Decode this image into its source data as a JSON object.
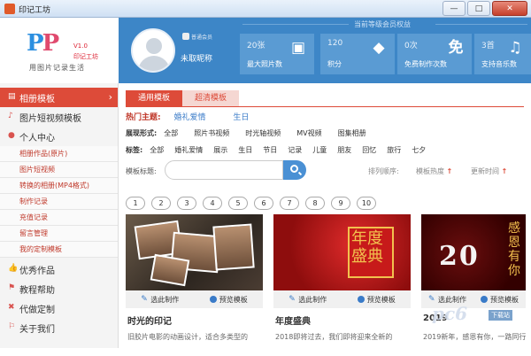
{
  "window": {
    "title": "印记工坊",
    "minimize": "—",
    "maximize": "□",
    "close": "✕"
  },
  "logo": {
    "mark_p1": "P",
    "mark_p2": "P",
    "version": "V1.0",
    "name": "印记工坊",
    "slogan": "用图片记录生活"
  },
  "user": {
    "badge_text": "普通会员",
    "nickname": "未取昵称"
  },
  "vip": {
    "title": "当前等级会员权益",
    "stats": [
      {
        "value": "20张",
        "label": "最大照片数",
        "icon": "image-icon",
        "glyph": "▣"
      },
      {
        "value": "120",
        "label": "积分",
        "icon": "diamond-icon",
        "glyph": "◆"
      },
      {
        "value": "0次",
        "label": "免费制作次数",
        "icon": "free-icon",
        "glyph": "免"
      },
      {
        "value": "3首",
        "label": "支持音乐数",
        "icon": "music-icon",
        "glyph": "♫"
      }
    ]
  },
  "sidebar": {
    "main_items": [
      {
        "label": "相册模板",
        "icon": "album-icon",
        "glyph": "▤",
        "active": true
      },
      {
        "label": "图片短视频模板",
        "icon": "tiktok-icon",
        "glyph": "♪"
      },
      {
        "label": "个人中心",
        "icon": "user-icon",
        "glyph": "●"
      }
    ],
    "sub_items": [
      "相册作品(原片)",
      "图片短视频",
      "转换的相册(MP4格式)",
      "制作记录",
      "充值记录",
      "留言管理",
      "我的定制模板"
    ],
    "bottom_items": [
      {
        "label": "优秀作品",
        "icon": "thumb-up-icon",
        "glyph": "👍"
      },
      {
        "label": "教程帮助",
        "icon": "help-icon",
        "glyph": "⚑"
      },
      {
        "label": "代做定制",
        "icon": "tools-icon",
        "glyph": "✖"
      },
      {
        "label": "关于我们",
        "icon": "info-icon",
        "glyph": "⚐"
      }
    ]
  },
  "tabs": [
    "通用模板",
    "超清模板"
  ],
  "hot_topics": {
    "label": "热门主题:",
    "items": [
      "婚礼爱情",
      "生日"
    ]
  },
  "filters": {
    "display": {
      "label": "展现形式:",
      "items": [
        "全部",
        "照片书视频",
        "时光轴视频",
        "MV视频",
        "图集相册"
      ]
    },
    "tags": {
      "label": "标签:",
      "items": [
        "全部",
        "婚礼爱情",
        "展示",
        "生日",
        "节日",
        "记录",
        "儿童",
        "朋友",
        "回忆",
        "旅行",
        "七夕"
      ]
    }
  },
  "search": {
    "label": "模板标题:",
    "placeholder": ""
  },
  "sort": {
    "label": "排列顺序:",
    "hot": "模板热度",
    "time": "更新时间",
    "up": "↑"
  },
  "pagination": [
    "1",
    "2",
    "3",
    "4",
    "5",
    "6",
    "7",
    "8",
    "9",
    "10"
  ],
  "cards": [
    {
      "title": "时光的印记",
      "desc": "旧胶片电影的动画设计，适合多类型的",
      "make": "选此制作",
      "preview": "预览模板"
    },
    {
      "title": "年度盛典",
      "desc": "2018即将过去，我们即将迎来全新的",
      "make": "选此制作",
      "preview": "预览模板",
      "art": "年度盛典"
    },
    {
      "title": "2019",
      "desc": "2019新年，感恩有你，一路同行",
      "make": "选此制作",
      "preview": "预览模板",
      "art_year": "20",
      "art_side": "感恩有你"
    }
  ],
  "watermark": {
    "text": "pc6",
    "sub": "下载站"
  }
}
